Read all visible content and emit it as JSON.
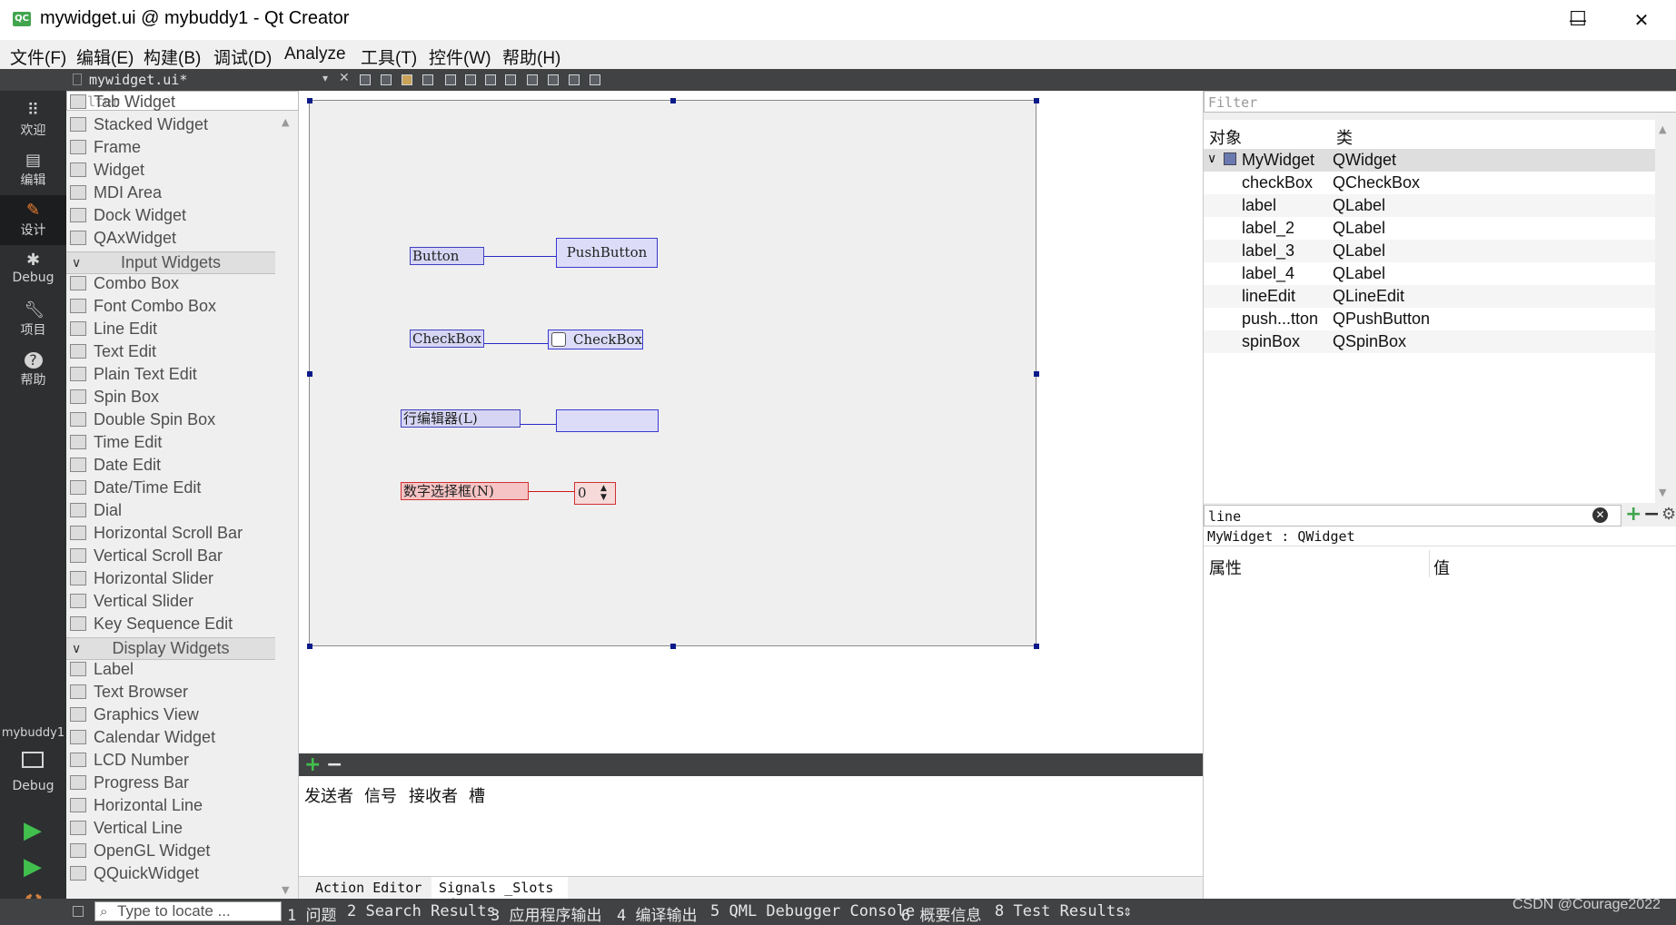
{
  "window": {
    "title": "mywidget.ui @ mybuddy1 - Qt Creator",
    "minimize": "—",
    "maximize": "☐",
    "close": "✕"
  },
  "menu": [
    "文件(F)",
    "编辑(E)",
    "构建(B)",
    "调试(D)",
    "Analyze",
    "工具(T)",
    "控件(W)",
    "帮助(H)"
  ],
  "toolbar": {
    "file_tab": "mywidget.ui*",
    "close": "✕"
  },
  "modes": [
    {
      "label": "欢迎",
      "icon": "grid-icon"
    },
    {
      "label": "编辑",
      "icon": "document-icon"
    },
    {
      "label": "设计",
      "icon": "pencil-icon"
    },
    {
      "label": "Debug",
      "icon": "bug-icon"
    },
    {
      "label": "项目",
      "icon": "wrench-icon"
    },
    {
      "label": "帮助",
      "icon": "help-icon"
    }
  ],
  "kit": {
    "project": "mybuddy1",
    "config": "Debug"
  },
  "widgetbox": {
    "filter_placeholder": "Filter",
    "items_top": [
      "Tab Widget",
      "Stacked Widget",
      "Frame",
      "Widget",
      "MDI Area",
      "Dock Widget",
      "QAxWidget"
    ],
    "cat_input": "Input Widgets",
    "items_input": [
      "Combo Box",
      "Font Combo Box",
      "Line Edit",
      "Text Edit",
      "Plain Text Edit",
      "Spin Box",
      "Double Spin Box",
      "Time Edit",
      "Date Edit",
      "Date/Time Edit",
      "Dial",
      "Horizontal Scroll Bar",
      "Vertical Scroll Bar",
      "Horizontal Slider",
      "Vertical Slider",
      "Key Sequence Edit"
    ],
    "cat_display": "Display Widgets",
    "items_display": [
      "Label",
      "Text Browser",
      "Graphics View",
      "Calendar Widget",
      "LCD Number",
      "Progress Bar",
      "Horizontal Line",
      "Vertical Line",
      "OpenGL Widget",
      "QQuickWidget"
    ]
  },
  "form": {
    "label_button": "Button",
    "push_button": "PushButton",
    "label_checkbox": "CheckBox",
    "checkbox": "CheckBox",
    "label_lineedit": "行编辑器(L)",
    "lineedit_value": "",
    "label_spin": "数字选择框(N)",
    "spin_value": "0"
  },
  "signal_slot": {
    "add": "+",
    "remove": "−",
    "headers": [
      "发送者",
      "信号",
      "接收者",
      "槽"
    ]
  },
  "bottom_tabs": [
    "Action Editor",
    "Signals _Slots Ed…"
  ],
  "object_inspector": {
    "filter_placeholder": "Filter",
    "col_object": "对象",
    "col_class": "类",
    "rows": [
      {
        "object": "MyWidget",
        "class": "QWidget"
      },
      {
        "object": "checkBox",
        "class": "QCheckBox"
      },
      {
        "object": "label",
        "class": "QLabel"
      },
      {
        "object": "label_2",
        "class": "QLabel"
      },
      {
        "object": "label_3",
        "class": "QLabel"
      },
      {
        "object": "label_4",
        "class": "QLabel"
      },
      {
        "object": "lineEdit",
        "class": "QLineEdit"
      },
      {
        "object": "push...tton",
        "class": "QPushButton"
      },
      {
        "object": "spinBox",
        "class": "QSpinBox"
      }
    ]
  },
  "property_editor": {
    "filter_value": "line",
    "class_line": "MyWidget : QWidget",
    "col_property": "属性",
    "col_value": "值"
  },
  "statusbar": {
    "locator_placeholder": "Type to locate ...",
    "items": [
      "1 问题",
      "2 Search Results",
      "3 应用程序输出",
      "4 编译输出",
      "5 QML Debugger Console",
      "6 概要信息",
      "8 Test Results"
    ],
    "more": "⇕"
  },
  "watermark": "CSDN @Courage2022",
  "colors": {
    "accent_green": "#41a54e",
    "dark_bar": "#404244",
    "mode_bar": "#2d2f31",
    "handle": "#0a1a8a"
  }
}
